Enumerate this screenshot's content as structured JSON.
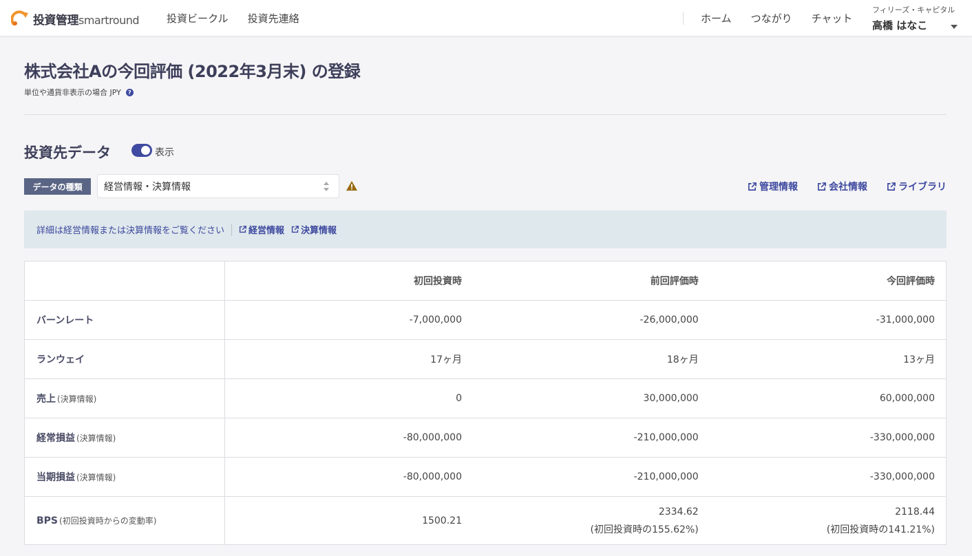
{
  "header": {
    "logo_main": "投資管理",
    "logo_sub": "smartround",
    "nav_left": [
      "投資ビークル",
      "投資先連絡"
    ],
    "nav_right": [
      "ホーム",
      "つながり",
      "チャット"
    ],
    "user_company": "フィリーズ・キャピタル",
    "user_name": "高橋 はなこ"
  },
  "page": {
    "title": "株式会社Aの今回評価 (2022年3月末) の登録",
    "unit_note": "単位や通貨非表示の場合 JPY"
  },
  "section": {
    "title": "投資先データ",
    "toggle_label": "表示",
    "type_label": "データの種類",
    "select_value": "経営情報・決算情報",
    "ext_links": [
      "管理情報",
      "会社情報",
      "ライブラリ"
    ]
  },
  "info": {
    "text": "詳細は経営情報または決算情報をご覧ください",
    "links": [
      "経営情報",
      "決算情報"
    ]
  },
  "table": {
    "headers": [
      "",
      "初回投資時",
      "前回評価時",
      "今回評価時"
    ],
    "rows": [
      {
        "label": "バーンレート",
        "note": "",
        "values": [
          "-7,000,000",
          "-26,000,000",
          "-31,000,000"
        ]
      },
      {
        "label": "ランウェイ",
        "note": "",
        "values": [
          "17ヶ月",
          "18ヶ月",
          "13ヶ月"
        ]
      },
      {
        "label": "売上",
        "note": "(決算情報)",
        "values": [
          "0",
          "30,000,000",
          "60,000,000"
        ]
      },
      {
        "label": "経常損益",
        "note": "(決算情報)",
        "values": [
          "-80,000,000",
          "-210,000,000",
          "-330,000,000"
        ]
      },
      {
        "label": "当期損益",
        "note": "(決算情報)",
        "values": [
          "-80,000,000",
          "-210,000,000",
          "-330,000,000"
        ]
      }
    ],
    "bps": {
      "label": "BPS",
      "note": "(初回投資時からの変動率)",
      "values": [
        "1500.21",
        "2334.62",
        "2118.44"
      ],
      "changes": [
        "",
        "(初回投資時の155.62%)",
        "(初回投資時の141.21%)"
      ]
    }
  },
  "colors": {
    "accent": "#3f4aa0",
    "title": "#3d3f5a",
    "logo_orange": "#f0932b",
    "warn": "#9a6a12",
    "info_bg": "#dfe8ec"
  },
  "icons": [
    "logo-icon",
    "help-icon",
    "warning-icon",
    "external-link-icon",
    "caret-down-icon"
  ]
}
